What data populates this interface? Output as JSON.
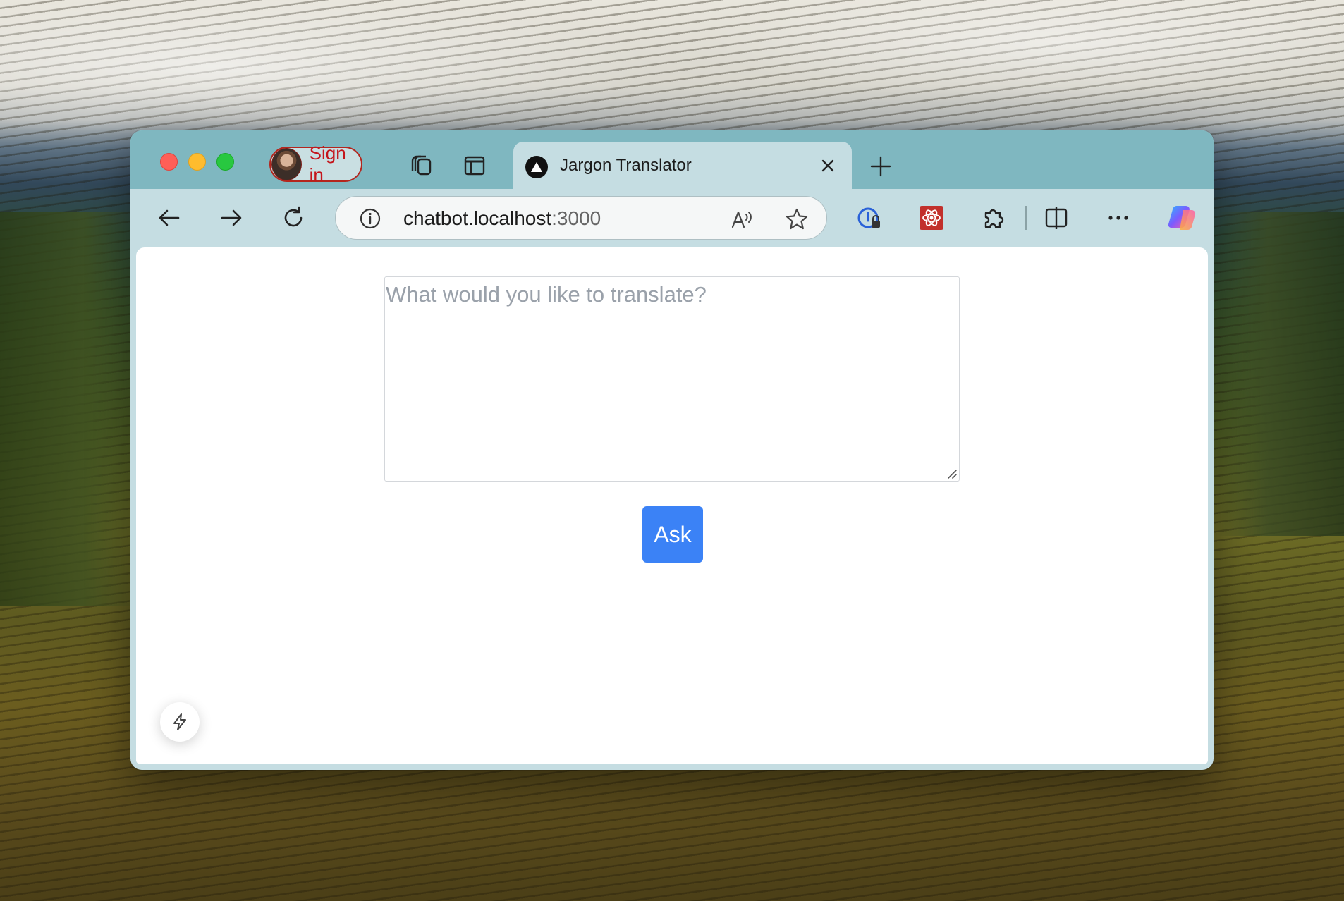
{
  "tabs": [
    {
      "title": "Jargon Translator",
      "favicon": "triangle-logo-icon",
      "active": true
    }
  ],
  "profile": {
    "signin_label": "Sign in"
  },
  "address": {
    "host": "chatbot.localhost",
    "port": ":3000"
  },
  "page": {
    "input_placeholder": "What would you like to translate?",
    "ask_label": "Ask"
  },
  "colors": {
    "tabstrip": "#7fb7c0",
    "toolbar": "#c5dde2",
    "ask_button": "#3b82f6",
    "signin": "#c4161c"
  }
}
